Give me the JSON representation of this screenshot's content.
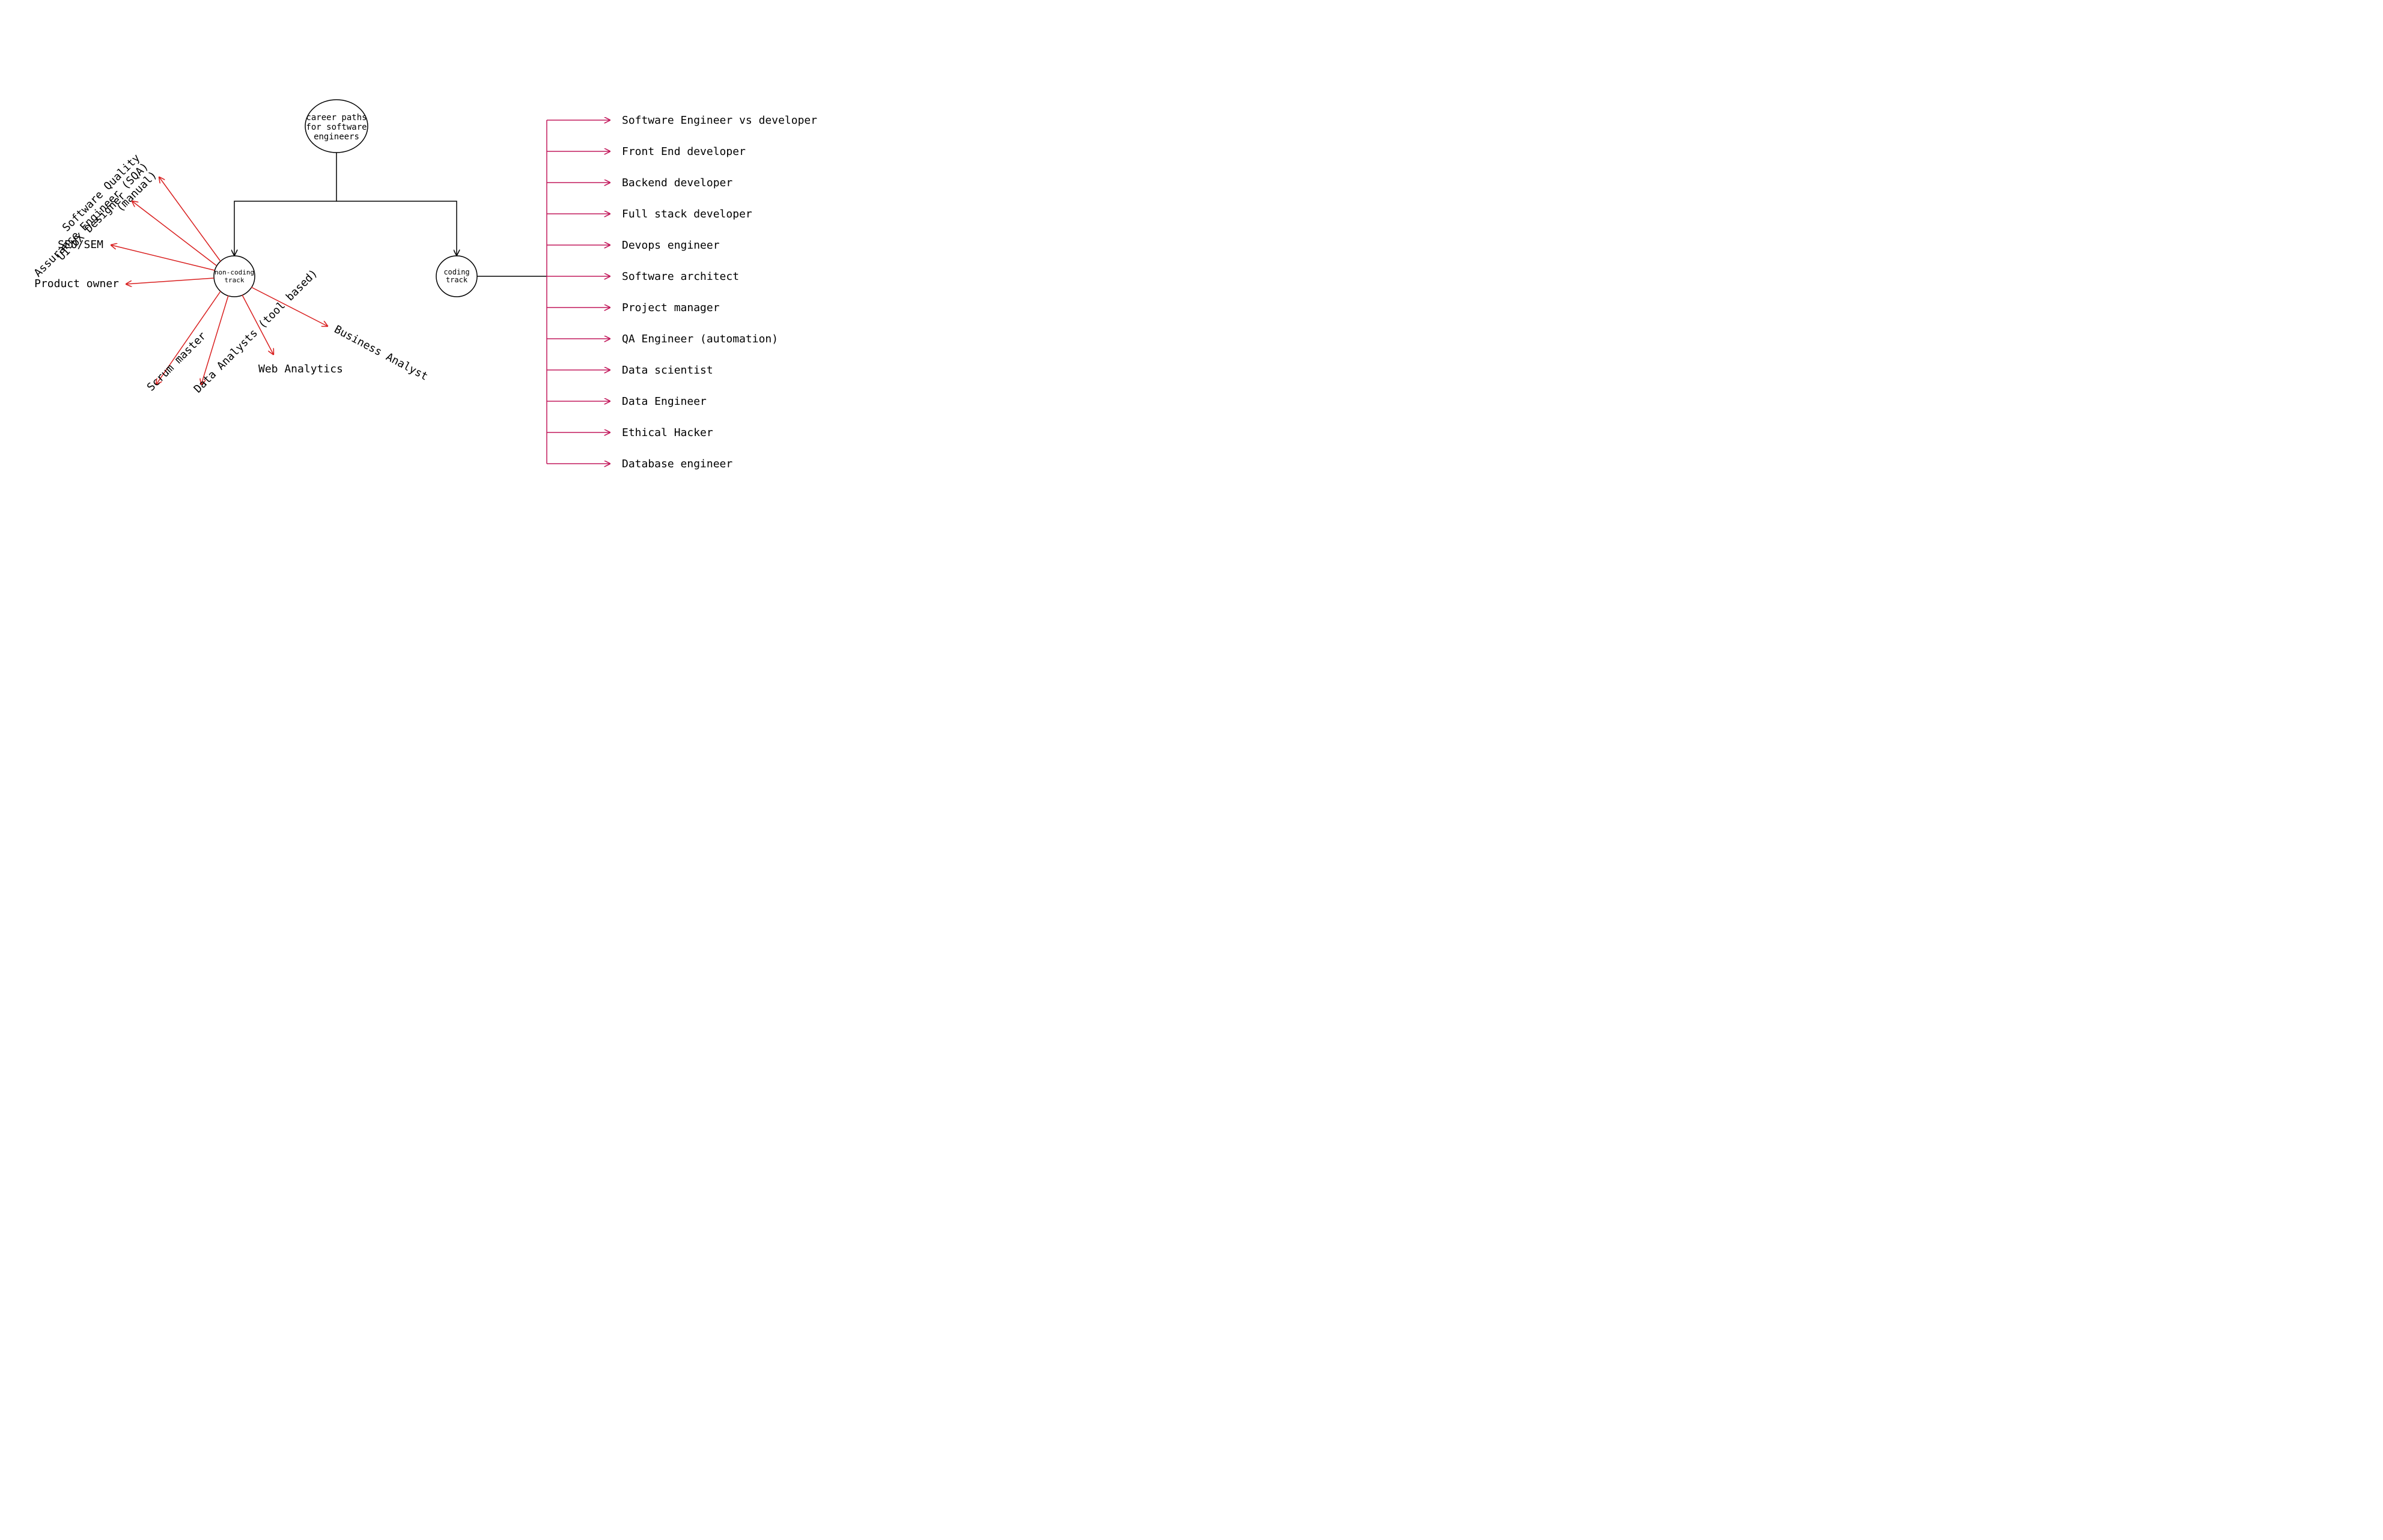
{
  "root": {
    "line1": "career paths",
    "line2": "for software",
    "line3": "engineers"
  },
  "nonCoding": {
    "label1": "non-coding",
    "label2": "track",
    "items": [
      "Software Quality",
      "Assurance Engineer (SQA)",
      "(manual)",
      "UI-UX Designer",
      "SEO/SEM",
      "Product owner",
      "Scrum master",
      "Data Analysts (tool based)",
      "Web Analytics",
      "Business Analyst"
    ]
  },
  "coding": {
    "label1": "coding",
    "label2": "track",
    "items": [
      "Software Engineer vs developer",
      "Front End developer",
      "Backend developer",
      "Full stack developer",
      "Devops engineer",
      "Software architect",
      "Project manager",
      "QA Engineer (automation)",
      "Data scientist",
      "Data Engineer",
      "Ethical Hacker",
      "Database engineer"
    ]
  },
  "colors": {
    "black": "#000000",
    "red": "#d92020",
    "crimson": "#c2185b"
  }
}
